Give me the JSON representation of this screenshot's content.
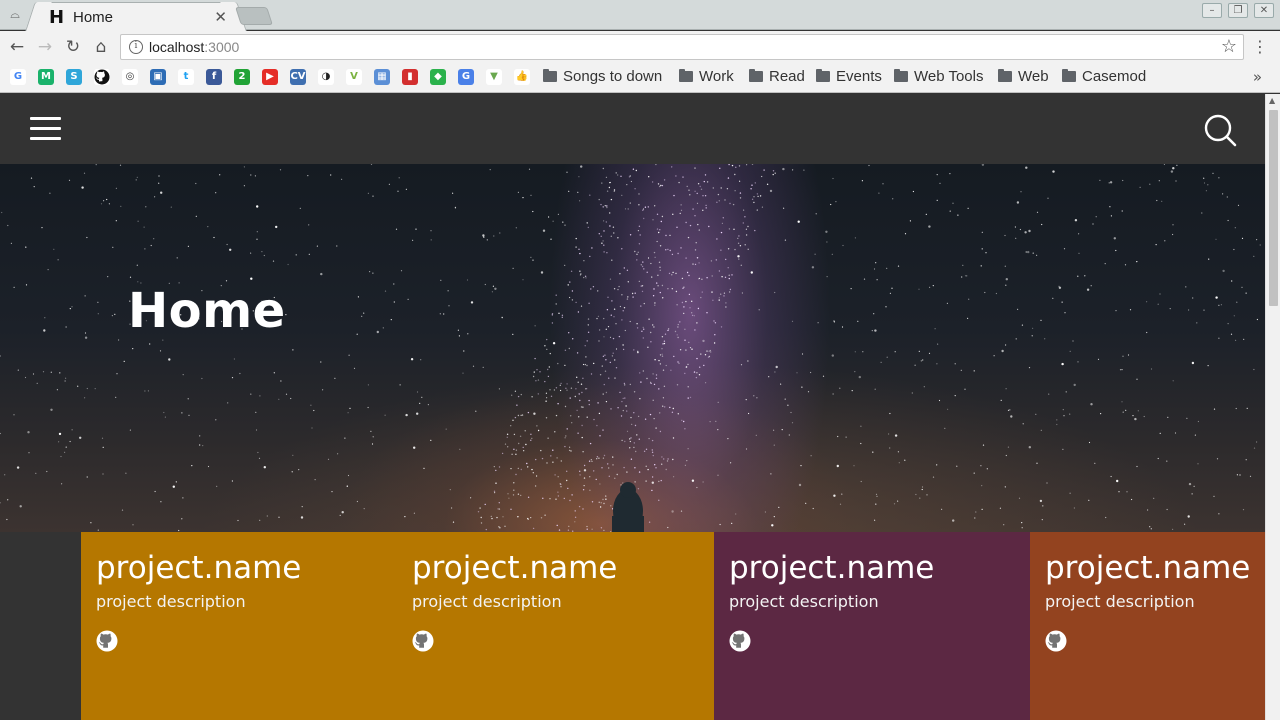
{
  "browser": {
    "tab_title": "Home",
    "tab_favicon": "H",
    "url_host": "localhost",
    "url_port": ":3000",
    "bookmark_icons": [
      {
        "name": "google-icon",
        "glyph": "G",
        "color": "#ffffff",
        "fg": "#4285f4"
      },
      {
        "name": "medium-icon",
        "glyph": "M",
        "color": "#1ab26b",
        "fg": "#ffffff"
      },
      {
        "name": "s-icon",
        "glyph": "S",
        "color": "#2fa6d9",
        "fg": "#ffffff"
      },
      {
        "name": "github-icon",
        "glyph": "",
        "color": "#ffffff",
        "fg": "#111111"
      },
      {
        "name": "circle-icon",
        "glyph": "◎",
        "color": "#ffffff",
        "fg": "#333333"
      },
      {
        "name": "bucket-icon",
        "glyph": "▣",
        "color": "#2d6cb5",
        "fg": "#ffffff"
      },
      {
        "name": "twitter-icon",
        "glyph": "t",
        "color": "#ffffff",
        "fg": "#1da1f2"
      },
      {
        "name": "facebook-icon",
        "glyph": "f",
        "color": "#3b5998",
        "fg": "#ffffff"
      },
      {
        "name": "two-icon",
        "glyph": "2",
        "color": "#21a336",
        "fg": "#ffffff"
      },
      {
        "name": "youtube-icon",
        "glyph": "▶",
        "color": "#e52d27",
        "fg": "#ffffff"
      },
      {
        "name": "cv-icon",
        "glyph": "CV",
        "color": "#3f6fb0",
        "fg": "#ffffff"
      },
      {
        "name": "glasses-icon",
        "glyph": "◑",
        "color": "#ffffff",
        "fg": "#222222"
      },
      {
        "name": "v-icon",
        "glyph": "V",
        "color": "#ffffff",
        "fg": "#7cb342"
      },
      {
        "name": "image-icon",
        "glyph": "▦",
        "color": "#5b8fd6",
        "fg": "#ffffff"
      },
      {
        "name": "chart-icon",
        "glyph": "▮",
        "color": "#d32f2f",
        "fg": "#ffffff"
      },
      {
        "name": "feedly-icon",
        "glyph": "◆",
        "color": "#2bb24c",
        "fg": "#ffffff"
      },
      {
        "name": "translate-icon",
        "glyph": "G",
        "color": "#4a80e8",
        "fg": "#ffffff"
      },
      {
        "name": "filter-icon",
        "glyph": "▼",
        "color": "#ffffff",
        "fg": "#6aa84f"
      },
      {
        "name": "thumbs-up-icon",
        "glyph": "👍",
        "color": "#ffffff",
        "fg": "#c98b4a"
      }
    ],
    "bookmark_folders": [
      "Songs to down",
      "Work",
      "Read",
      "Events",
      "Web Tools",
      "Web",
      "Casemod"
    ]
  },
  "page": {
    "hero_title": "Home",
    "colors": {
      "header_bg": "#333333",
      "card_gold": "#b57700",
      "card_plum": "#5c2843",
      "card_rust": "#93431f"
    },
    "projects": [
      {
        "name": "project.name",
        "description": "project description",
        "color": "#b57700"
      },
      {
        "name": "project.name",
        "description": "project description",
        "color": "#b57700"
      },
      {
        "name": "project.name",
        "description": "project description",
        "color": "#5c2843"
      },
      {
        "name": "project.name",
        "description": "project description",
        "color": "#93431f"
      }
    ]
  }
}
